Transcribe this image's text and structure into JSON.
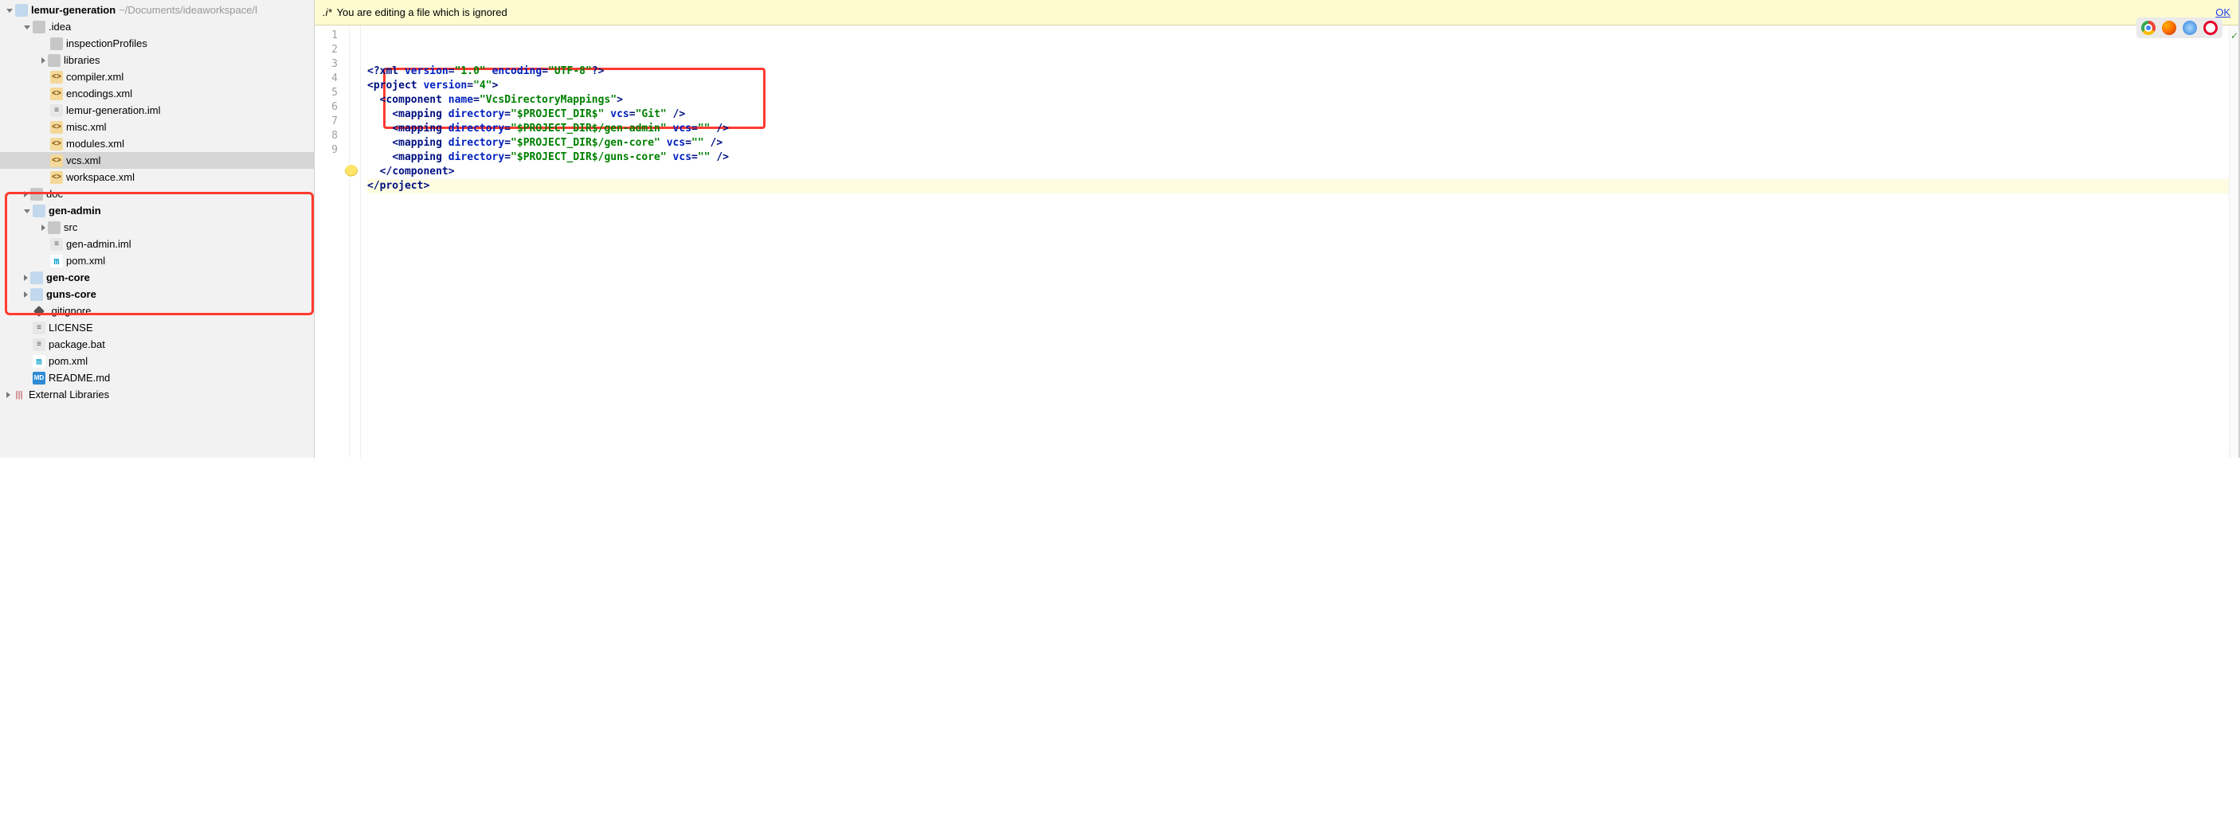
{
  "project": {
    "root_name": "lemur-generation",
    "root_path": "~/Documents/ideaworkspace/l",
    "tree": [
      {
        "indent": 0,
        "arrow": "down",
        "icon": "folder",
        "bold": true,
        "label": "lemur-generation",
        "path": "~/Documents/ideaworkspace/l"
      },
      {
        "indent": 1,
        "arrow": "down",
        "icon": "folder-grey",
        "label": ".idea"
      },
      {
        "indent": 2,
        "arrow": "none",
        "icon": "folder-grey",
        "label": "inspectionProfiles"
      },
      {
        "indent": 2,
        "arrow": "right",
        "icon": "folder-grey",
        "label": "libraries"
      },
      {
        "indent": 2,
        "arrow": "none",
        "icon": "xml",
        "label": "compiler.xml"
      },
      {
        "indent": 2,
        "arrow": "none",
        "icon": "xml",
        "label": "encodings.xml"
      },
      {
        "indent": 2,
        "arrow": "none",
        "icon": "iml",
        "label": "lemur-generation.iml"
      },
      {
        "indent": 2,
        "arrow": "none",
        "icon": "xml",
        "label": "misc.xml"
      },
      {
        "indent": 2,
        "arrow": "none",
        "icon": "xml",
        "label": "modules.xml"
      },
      {
        "indent": 2,
        "arrow": "none",
        "icon": "xml",
        "label": "vcs.xml",
        "selected": true
      },
      {
        "indent": 2,
        "arrow": "none",
        "icon": "xml",
        "label": "workspace.xml"
      },
      {
        "indent": 1,
        "arrow": "right",
        "icon": "folder-grey",
        "label": "doc"
      },
      {
        "indent": 1,
        "arrow": "down",
        "icon": "folder",
        "bold": true,
        "label": "gen-admin"
      },
      {
        "indent": 2,
        "arrow": "right",
        "icon": "folder-grey",
        "label": "src"
      },
      {
        "indent": 2,
        "arrow": "none",
        "icon": "iml",
        "label": "gen-admin.iml"
      },
      {
        "indent": 2,
        "arrow": "none",
        "icon": "m",
        "label": "pom.xml"
      },
      {
        "indent": 1,
        "arrow": "right",
        "icon": "folder",
        "bold": true,
        "label": "gen-core"
      },
      {
        "indent": 1,
        "arrow": "right",
        "icon": "folder",
        "bold": true,
        "label": "guns-core"
      },
      {
        "indent": 1,
        "arrow": "none",
        "icon": "diamond",
        "label": ".gitignore"
      },
      {
        "indent": 1,
        "arrow": "none",
        "icon": "txt",
        "label": "LICENSE"
      },
      {
        "indent": 1,
        "arrow": "none",
        "icon": "txt",
        "label": "package.bat"
      },
      {
        "indent": 1,
        "arrow": "none",
        "icon": "m",
        "label": "pom.xml"
      },
      {
        "indent": 1,
        "arrow": "none",
        "icon": "md",
        "label": "README.md"
      },
      {
        "indent": 0,
        "arrow": "right",
        "icon": "extlib",
        "label": "External Libraries"
      }
    ]
  },
  "banner": {
    "filename": ".i*",
    "message": "You are editing a file which is ignored",
    "ok_label": "OK"
  },
  "gutter_lines": [
    "1",
    "2",
    "3",
    "4",
    "5",
    "6",
    "7",
    "8",
    "9"
  ],
  "code_tokens": [
    [
      {
        "c": "t-bracket",
        "t": "<?"
      },
      {
        "c": "t-tag",
        "t": "xml "
      },
      {
        "c": "t-attr",
        "t": "version"
      },
      {
        "c": "t-bracket",
        "t": "="
      },
      {
        "c": "t-str",
        "t": "\"1.0\""
      },
      {
        "c": "",
        "t": " "
      },
      {
        "c": "t-attr",
        "t": "encoding"
      },
      {
        "c": "t-bracket",
        "t": "="
      },
      {
        "c": "t-str",
        "t": "\"UTF-8\""
      },
      {
        "c": "t-bracket",
        "t": "?>"
      }
    ],
    [
      {
        "c": "t-bracket",
        "t": "<"
      },
      {
        "c": "t-tag",
        "t": "project "
      },
      {
        "c": "t-attr",
        "t": "version"
      },
      {
        "c": "t-bracket",
        "t": "="
      },
      {
        "c": "t-str",
        "t": "\"4\""
      },
      {
        "c": "t-bracket",
        "t": ">"
      }
    ],
    [
      {
        "c": "",
        "t": "  "
      },
      {
        "c": "t-bracket",
        "t": "<"
      },
      {
        "c": "t-tag",
        "t": "component "
      },
      {
        "c": "t-attr",
        "t": "name"
      },
      {
        "c": "t-bracket",
        "t": "="
      },
      {
        "c": "t-str",
        "t": "\"VcsDirectoryMappings\""
      },
      {
        "c": "t-bracket",
        "t": ">"
      }
    ],
    [
      {
        "c": "",
        "t": "    "
      },
      {
        "c": "t-bracket",
        "t": "<"
      },
      {
        "c": "t-tag",
        "t": "mapping "
      },
      {
        "c": "t-attr",
        "t": "directory"
      },
      {
        "c": "t-bracket",
        "t": "="
      },
      {
        "c": "t-str",
        "t": "\"$PROJECT_DIR$\""
      },
      {
        "c": "",
        "t": " "
      },
      {
        "c": "t-attr",
        "t": "vcs"
      },
      {
        "c": "t-bracket",
        "t": "="
      },
      {
        "c": "t-str",
        "t": "\"Git\""
      },
      {
        "c": "",
        "t": " "
      },
      {
        "c": "t-bracket",
        "t": "/>"
      }
    ],
    [
      {
        "c": "",
        "t": "    "
      },
      {
        "c": "t-bracket",
        "t": "<"
      },
      {
        "c": "t-tag",
        "t": "mapping "
      },
      {
        "c": "t-attr",
        "t": "directory"
      },
      {
        "c": "t-bracket",
        "t": "="
      },
      {
        "c": "t-str",
        "t": "\"$PROJECT_DIR$/gen-admin\""
      },
      {
        "c": "",
        "t": " "
      },
      {
        "c": "t-attr",
        "t": "vcs"
      },
      {
        "c": "t-bracket",
        "t": "="
      },
      {
        "c": "t-str",
        "t": "\"\""
      },
      {
        "c": "",
        "t": " "
      },
      {
        "c": "t-bracket",
        "t": "/>"
      }
    ],
    [
      {
        "c": "",
        "t": "    "
      },
      {
        "c": "t-bracket",
        "t": "<"
      },
      {
        "c": "t-tag",
        "t": "mapping "
      },
      {
        "c": "t-attr",
        "t": "directory"
      },
      {
        "c": "t-bracket",
        "t": "="
      },
      {
        "c": "t-str",
        "t": "\"$PROJECT_DIR$/gen-core\""
      },
      {
        "c": "",
        "t": " "
      },
      {
        "c": "t-attr",
        "t": "vcs"
      },
      {
        "c": "t-bracket",
        "t": "="
      },
      {
        "c": "t-str",
        "t": "\"\""
      },
      {
        "c": "",
        "t": " "
      },
      {
        "c": "t-bracket",
        "t": "/>"
      }
    ],
    [
      {
        "c": "",
        "t": "    "
      },
      {
        "c": "t-bracket",
        "t": "<"
      },
      {
        "c": "t-tag",
        "t": "mapping "
      },
      {
        "c": "t-attr",
        "t": "directory"
      },
      {
        "c": "t-bracket",
        "t": "="
      },
      {
        "c": "t-str",
        "t": "\"$PROJECT_DIR$/guns-core\""
      },
      {
        "c": "",
        "t": " "
      },
      {
        "c": "t-attr",
        "t": "vcs"
      },
      {
        "c": "t-bracket",
        "t": "="
      },
      {
        "c": "t-str",
        "t": "\"\""
      },
      {
        "c": "",
        "t": " "
      },
      {
        "c": "t-bracket",
        "t": "/>"
      }
    ],
    [
      {
        "c": "",
        "t": "  "
      },
      {
        "c": "t-bracket",
        "t": "</"
      },
      {
        "c": "t-tag",
        "t": "component"
      },
      {
        "c": "t-bracket",
        "t": ">"
      }
    ],
    [
      {
        "c": "t-bracket",
        "t": "</"
      },
      {
        "c": "t-tag",
        "t": "project"
      },
      {
        "c": "t-bracket",
        "t": ">"
      }
    ]
  ],
  "caret_line_index": 8,
  "bulb_line_index": 7,
  "browsers": [
    "chrome",
    "ff",
    "safari",
    "opera"
  ]
}
